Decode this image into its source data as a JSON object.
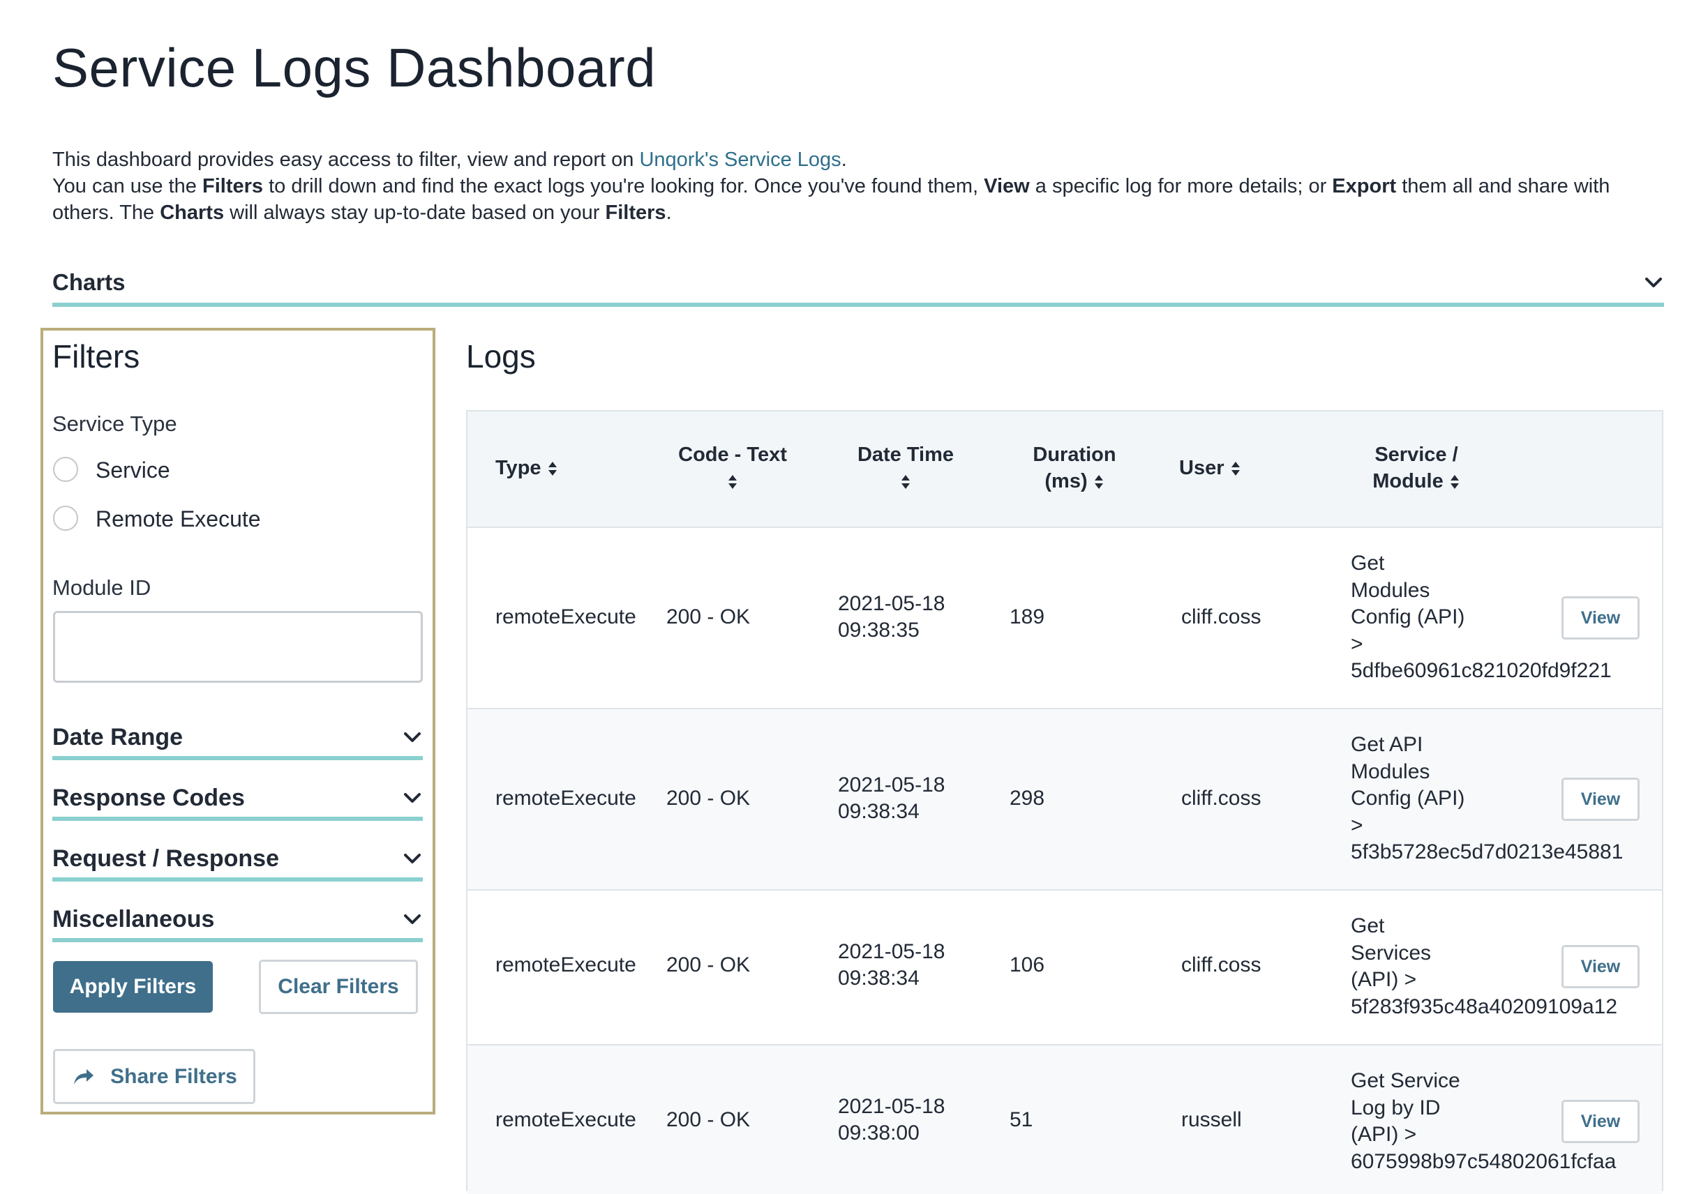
{
  "page": {
    "title": "Service Logs Dashboard",
    "intro": {
      "line1_prefix": "This dashboard provides easy access to filter, view and report on ",
      "line1_link": "Unqork's Service Logs",
      "line1_suffix": ".",
      "line2_a": "You can use the ",
      "line2_b": "Filters",
      "line2_c": " to drill down and find the exact logs you're looking for. Once you've found them, ",
      "line2_d": "View",
      "line2_e": " a specific log for more details; or ",
      "line2_f": "Export",
      "line2_g": " them all and share with others. The ",
      "line2_h": "Charts",
      "line2_i": " will always stay up-to-date based on your ",
      "line2_j": "Filters",
      "line2_k": "."
    },
    "charts_label": "Charts"
  },
  "filters": {
    "title": "Filters",
    "service_type_label": "Service Type",
    "options": [
      "Service",
      "Remote Execute"
    ],
    "module_id_label": "Module ID",
    "module_id_value": "",
    "sections": [
      "Date Range",
      "Response Codes",
      "Request / Response",
      "Miscellaneous"
    ],
    "apply_label": "Apply Filters",
    "clear_label": "Clear Filters",
    "share_label": "Share Filters"
  },
  "logs": {
    "title": "Logs",
    "columns": {
      "type": "Type",
      "code": "Code - Text",
      "datetime": "Date Time",
      "duration_1": "Duration",
      "duration_2": "(ms)",
      "user": "User",
      "service_1": "Service /",
      "service_2": "Module"
    },
    "view_label": "View",
    "rows": [
      {
        "type": "remoteExecute",
        "code": "200 - OK",
        "date": "2021-05-18",
        "time": "09:38:35",
        "duration": "189",
        "user": "cliff.coss",
        "service": [
          "Get",
          "Modules",
          "Config (API)",
          ">",
          "5dfbe60961c821020fd9f221"
        ]
      },
      {
        "type": "remoteExecute",
        "code": "200 - OK",
        "date": "2021-05-18",
        "time": "09:38:34",
        "duration": "298",
        "user": "cliff.coss",
        "service": [
          "Get API",
          "Modules",
          "Config (API)",
          ">",
          "5f3b5728ec5d7d0213e45881"
        ]
      },
      {
        "type": "remoteExecute",
        "code": "200 - OK",
        "date": "2021-05-18",
        "time": "09:38:34",
        "duration": "106",
        "user": "cliff.coss",
        "service": [
          "Get",
          "Services",
          "(API) >",
          "5f283f935c48a40209109a12"
        ]
      },
      {
        "type": "remoteExecute",
        "code": "200 - OK",
        "date": "2021-05-18",
        "time": "09:38:00",
        "duration": "51",
        "user": "russell",
        "service": [
          "Get Service",
          "Log by ID",
          "(API) >",
          "6075998b97c54802061fcfaa"
        ]
      }
    ]
  }
}
